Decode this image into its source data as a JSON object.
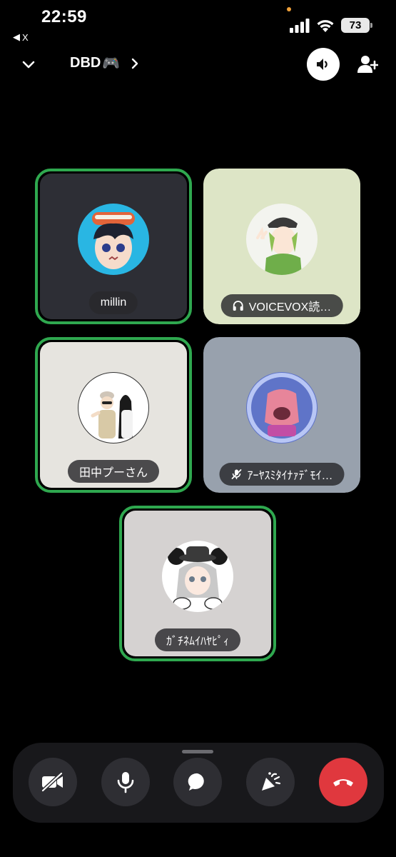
{
  "status_bar": {
    "time": "22:59",
    "back_label": "X",
    "battery": "73"
  },
  "header": {
    "channel_name": "DBD",
    "channel_emoji": "🎮"
  },
  "participants": [
    {
      "name": "millin",
      "speaking": true,
      "status_icon": "none"
    },
    {
      "name": "VOICEVOX読…",
      "speaking": false,
      "status_icon": "headphones-icon"
    },
    {
      "name": "田中プーさん",
      "speaking": true,
      "status_icon": "none"
    },
    {
      "name": "ｱｰﾔｽﾐﾀｲﾅｧﾃﾞﾓｲ…",
      "speaking": false,
      "status_icon": "mic-muted-icon"
    },
    {
      "name": "ｶﾞﾁﾈﾑｲﾊﾔﾋﾟｨ",
      "speaking": true,
      "status_icon": "none"
    }
  ],
  "controls": [
    {
      "name": "camera-off-button",
      "icon": "camera-off-icon"
    },
    {
      "name": "microphone-button",
      "icon": "microphone-icon"
    },
    {
      "name": "chat-button",
      "icon": "chat-bubble-icon"
    },
    {
      "name": "soundboard-button",
      "icon": "party-popper-icon"
    },
    {
      "name": "disconnect-button",
      "icon": "hang-up-icon"
    }
  ],
  "colors": {
    "speaking_ring": "#2fa84f",
    "hangup": "#e0383e",
    "control_bg": "#2e2e33"
  }
}
